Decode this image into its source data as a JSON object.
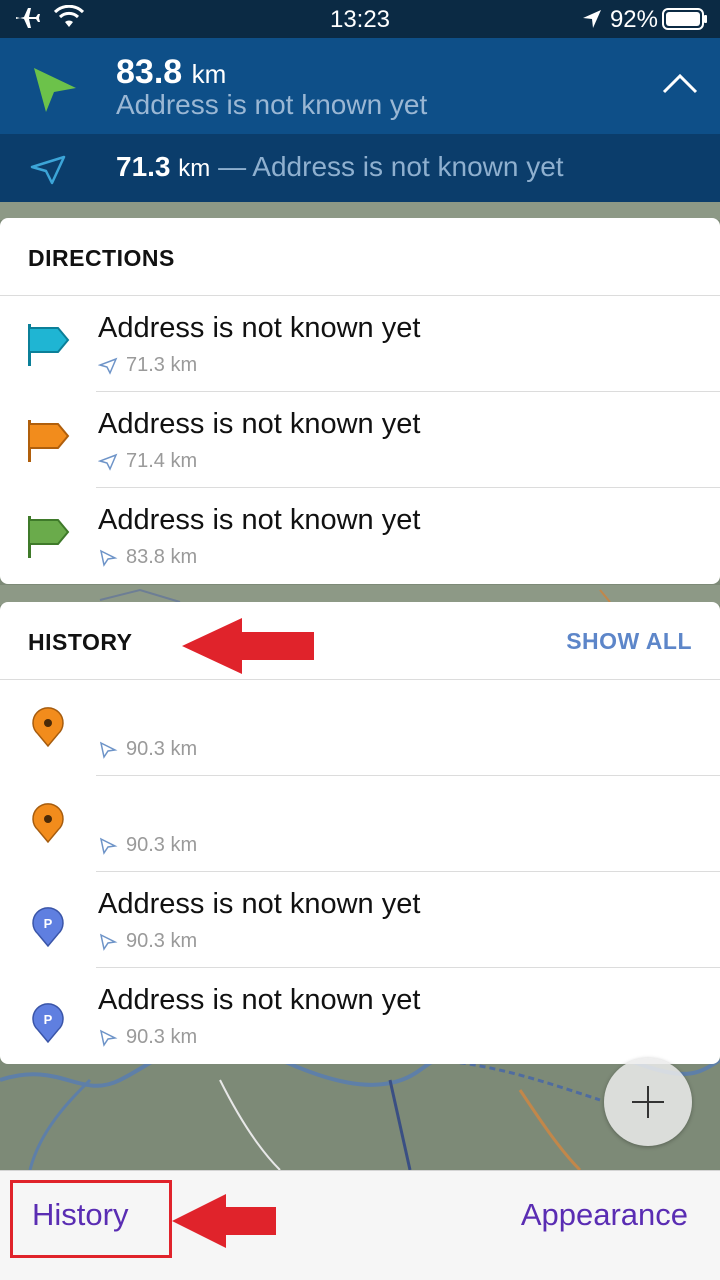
{
  "status_bar": {
    "time": "13:23",
    "battery_pct": "92%"
  },
  "nav": {
    "primary_distance": "83.8",
    "primary_unit": "km",
    "primary_address": "Address is not known yet",
    "secondary_distance": "71.3",
    "secondary_unit": "km",
    "secondary_sep": "—",
    "secondary_address": "Address is not known yet"
  },
  "directions": {
    "title": "DIRECTIONS",
    "items": [
      {
        "name": "Address is not known yet",
        "distance": "71.3 km",
        "flag_color": "#1fb5d3"
      },
      {
        "name": "Address is not known yet",
        "distance": "71.4 km",
        "flag_color": "#f28c1c"
      },
      {
        "name": "Address is not known yet",
        "distance": "83.8 km",
        "flag_color": "#6aab4b"
      }
    ]
  },
  "history": {
    "title": "HISTORY",
    "show_all": "SHOW ALL",
    "items": [
      {
        "name": "",
        "distance": "90.3 km",
        "icon": "orange-pin-icon"
      },
      {
        "name": "",
        "distance": "90.3 km",
        "icon": "orange-pin-icon"
      },
      {
        "name": "Address is not known yet",
        "distance": "90.3 km",
        "icon": "parking-pin-icon"
      },
      {
        "name": "Address is not known yet",
        "distance": "90.3 km",
        "icon": "parking-pin-icon"
      }
    ]
  },
  "parking_letter": "P",
  "toolbar": {
    "history_label": "History",
    "appearance_label": "Appearance"
  },
  "colors": {
    "accent": "#5a2db3",
    "nav_primary": "#0e4f88",
    "nav_secondary": "#0b3d6b",
    "annotation": "#e0232b"
  }
}
